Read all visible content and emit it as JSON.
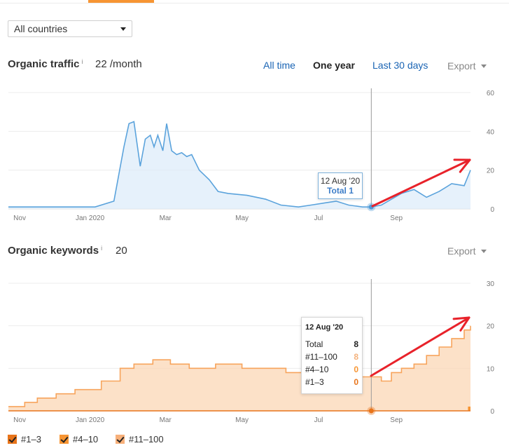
{
  "country_filter": {
    "value": "All countries"
  },
  "traffic": {
    "title": "Organic traffic",
    "info": "i",
    "value": "22 /month",
    "ranges": [
      "All time",
      "One year",
      "Last 30 days"
    ],
    "active_range": "One year",
    "export_label": "Export",
    "tooltip": {
      "date": "12 Aug '20",
      "total": "Total 1"
    },
    "color": "#5ba3dc"
  },
  "keywords": {
    "title": "Organic keywords",
    "info": "i",
    "value": "20",
    "export_label": "Export",
    "tooltip": {
      "date": "12 Aug '20",
      "rows": [
        {
          "label": "Total",
          "value": "8",
          "color": "#222222"
        },
        {
          "label": "#11–100",
          "value": "8",
          "color": "#f4b27c"
        },
        {
          "label": "#4–10",
          "value": "0",
          "color": "#f79533"
        },
        {
          "label": "#1–3",
          "value": "0",
          "color": "#e8741a"
        }
      ]
    },
    "color": "#f7a45c"
  },
  "legend": [
    {
      "label": "#1–3",
      "color": "#e8741a"
    },
    {
      "label": "#4–10",
      "color": "#f79533"
    },
    {
      "label": "#11–100",
      "color": "#f7b07a"
    }
  ],
  "chart_data": [
    {
      "type": "area",
      "x_labels": [
        "Nov",
        "Jan 2020",
        "Mar",
        "May",
        "Jul",
        "Sep"
      ],
      "y_ticks": [
        0,
        20,
        40,
        60
      ],
      "ylim": [
        0,
        60
      ],
      "grid": true,
      "series": [
        {
          "name": "Organic traffic",
          "x": [
            "2019-10-28",
            "2019-11-15",
            "2019-12-10",
            "2020-01-05",
            "2020-01-20",
            "2020-01-28",
            "2020-02-01",
            "2020-02-05",
            "2020-02-10",
            "2020-02-14",
            "2020-02-18",
            "2020-02-21",
            "2020-02-24",
            "2020-02-28",
            "2020-03-02",
            "2020-03-06",
            "2020-03-10",
            "2020-03-14",
            "2020-03-18",
            "2020-03-22",
            "2020-03-28",
            "2020-04-05",
            "2020-04-12",
            "2020-04-20",
            "2020-05-05",
            "2020-05-20",
            "2020-06-01",
            "2020-06-15",
            "2020-06-25",
            "2020-07-05",
            "2020-07-15",
            "2020-07-25",
            "2020-08-05",
            "2020-08-12",
            "2020-08-20",
            "2020-08-28",
            "2020-09-05",
            "2020-09-15",
            "2020-09-25",
            "2020-10-05",
            "2020-10-15",
            "2020-10-25",
            "2020-10-30"
          ],
          "values": [
            1,
            1,
            1,
            1,
            4,
            32,
            44,
            45,
            22,
            36,
            38,
            32,
            38,
            30,
            44,
            30,
            28,
            29,
            27,
            28,
            20,
            15,
            9,
            8,
            7,
            5,
            2,
            1,
            2,
            3,
            4,
            2,
            1,
            1,
            2,
            5,
            8,
            10,
            6,
            9,
            13,
            12,
            20
          ]
        }
      ]
    },
    {
      "type": "area",
      "x_labels": [
        "Nov",
        "Jan 2020",
        "Mar",
        "May",
        "Jul",
        "Sep"
      ],
      "y_ticks": [
        0,
        10,
        20,
        30
      ],
      "ylim": [
        0,
        30
      ],
      "grid": true,
      "series": [
        {
          "name": "#11–100",
          "x": [
            "2019-10-28",
            "2019-11-10",
            "2019-11-20",
            "2019-12-05",
            "2019-12-20",
            "2020-01-10",
            "2020-01-25",
            "2020-02-05",
            "2020-02-20",
            "2020-03-05",
            "2020-03-20",
            "2020-04-10",
            "2020-05-01",
            "2020-05-20",
            "2020-06-05",
            "2020-06-20",
            "2020-07-05",
            "2020-07-20",
            "2020-08-05",
            "2020-08-12",
            "2020-08-20",
            "2020-08-28",
            "2020-09-05",
            "2020-09-15",
            "2020-09-25",
            "2020-10-05",
            "2020-10-15",
            "2020-10-25",
            "2020-10-30"
          ],
          "values": [
            1,
            2,
            3,
            4,
            5,
            7,
            10,
            11,
            12,
            11,
            10,
            11,
            10,
            10,
            9,
            8,
            7,
            8,
            8,
            8,
            7,
            9,
            10,
            11,
            13,
            15,
            17,
            19,
            20
          ]
        },
        {
          "name": "#4–10",
          "x": [
            "2020-10-28",
            "2020-10-30"
          ],
          "values": [
            0,
            1
          ]
        },
        {
          "name": "#1–3",
          "x": [
            "2019-10-28",
            "2020-10-30"
          ],
          "values": [
            0,
            0
          ]
        }
      ]
    }
  ]
}
